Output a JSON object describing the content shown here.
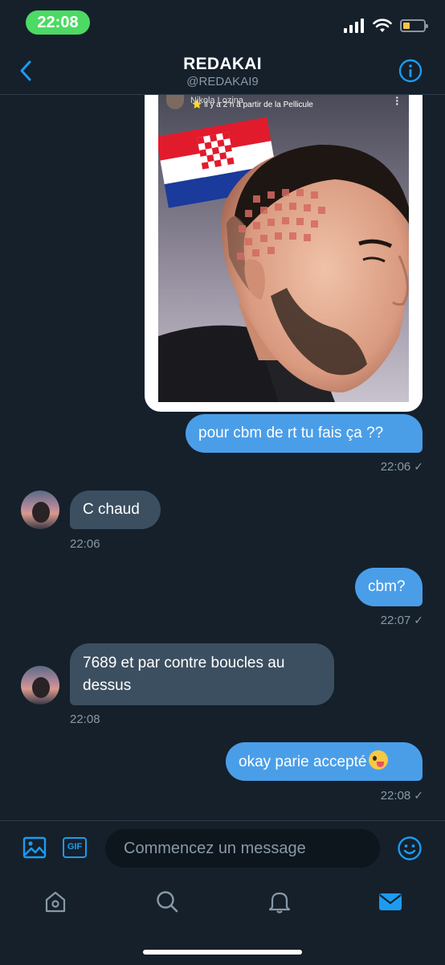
{
  "status_bar": {
    "time": "22:08",
    "icons": [
      "signal-icon",
      "wifi-icon",
      "battery-icon"
    ],
    "time_pill_color": "#4cd964",
    "battery_level": 0.2
  },
  "header": {
    "title": "REDAKAI",
    "handle": "@REDAKAI9",
    "back_icon": "chevron-left-icon",
    "info_icon": "info-icon",
    "accent_color": "#1d9bf0"
  },
  "shared_image": {
    "story_owner": "Nikola Lozina",
    "story_time": "⭐ il y a 2 h à partir de la Pellicule"
  },
  "messages": [
    {
      "direction": "out",
      "text": "pour cbm de rt tu fais ça ??",
      "time": "22:06",
      "status_icon": "✓"
    },
    {
      "direction": "in",
      "text": "C chaud",
      "time": "22:06"
    },
    {
      "direction": "out",
      "text": "cbm?",
      "time": "22:07",
      "status_icon": "✓"
    },
    {
      "direction": "in",
      "text": "7689 et par contre boucles au dessus",
      "time": "22:08"
    },
    {
      "direction": "out",
      "text": "okay parie accepté",
      "time": "22:08",
      "status_icon": "✓",
      "emoji": "zany-face-emoji"
    }
  ],
  "composer": {
    "placeholder": "Commencez un message",
    "gif_label": "GIF"
  },
  "tabs": [
    {
      "name": "home",
      "icon": "home-icon"
    },
    {
      "name": "search",
      "icon": "search-icon"
    },
    {
      "name": "notifications",
      "icon": "bell-icon"
    },
    {
      "name": "messages",
      "icon": "mail-icon",
      "active": true
    }
  ]
}
